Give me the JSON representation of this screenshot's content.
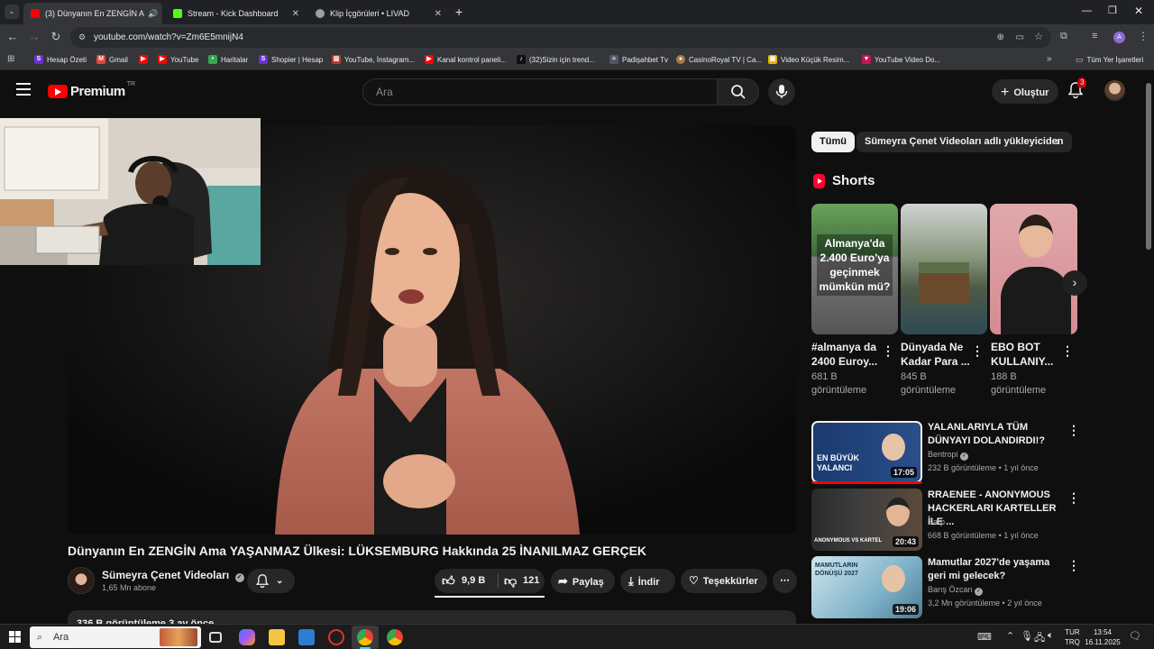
{
  "browser": {
    "tabs": [
      {
        "title": "(3) Dünyanın En ZENGİN A",
        "active": true
      },
      {
        "title": "Stream - Kick Dashboard",
        "active": false
      },
      {
        "title": "Klip İçgörüleri • LIVAD",
        "active": false
      }
    ],
    "url": "youtube.com/watch?v=Zm6E5mnijN4",
    "bookmarks": [
      "Hesap Özeti",
      "Gmail",
      "YouTube",
      "Haritalar",
      "Shopier | Hesap",
      "YouTube, İnstagram...",
      "Kanal kontrol paneli...",
      "(32)Sizin için trend...",
      "Padişahbet Tv",
      "CasinoRoyal TV | Ca...",
      "Video Küçük Resim...",
      "YouTube Video Do..."
    ],
    "all_bookmarks": "Tüm Yer İşaretleri",
    "profile_initial": "A"
  },
  "youtube": {
    "logo_text": "Premium",
    "region": "TR",
    "search_placeholder": "Ara",
    "create_label": "Oluştur",
    "notification_count": "3"
  },
  "video": {
    "title": "Dünyanın En ZENGİN Ama YAŞANMAZ Ülkesi: LÜKSEMBURG Hakkında 25 İNANILMAZ GERÇEK",
    "channel": "Sümeyra Çenet Videoları",
    "subscribers": "1,65 Mn abone",
    "likes": "9,9 B",
    "dislikes": "121",
    "share_label": "Paylaş",
    "download_label": "İndir",
    "thanks_label": "Teşekkürler",
    "description_preview": "336 B görüntüleme  3 ay önce"
  },
  "sidebar": {
    "chips": [
      "Tümü",
      "Sümeyra Çenet Videoları adlı yükleyiciden"
    ],
    "shorts_heading": "Shorts",
    "shorts": [
      {
        "title": "#almanya da 2400 Euroy...",
        "views": "681 B görüntüleme",
        "thumb_text": "Almanya'da 2.400 Euro'ya geçinmek mümkün mü?"
      },
      {
        "title": "Dünyada Ne Kadar Para ...",
        "views": "845 B görüntüleme",
        "thumb_text": ""
      },
      {
        "title": "EBO BOT KULLANIY...",
        "views": "188 B görüntüleme",
        "thumb_text": ""
      }
    ],
    "related": [
      {
        "title": "YALANLARIYLA TÜM DÜNYAYI DOLANDIRDI!?",
        "channel": "Bentropi",
        "views": "232 B görüntüleme",
        "age": "1 yıl önce",
        "duration": "17:05",
        "thumb_text": "EN BÜYÜK YALANCI",
        "verified": true
      },
      {
        "title": "RRAENEE - ANONYMOUS HACKERLARI KARTELLER İLE ...",
        "channel": "Sarp",
        "views": "668 B görüntüleme",
        "age": "1 yıl önce",
        "duration": "20:43",
        "thumb_text": "ANONYMOUS VS KARTEL",
        "verified": false
      },
      {
        "title": "Mamutlar 2027'de yaşama geri mi gelecek?",
        "channel": "Barış Özcan",
        "views": "3,2 Mn görüntüleme",
        "age": "2 yıl önce",
        "duration": "19:06",
        "thumb_text": "MAMUTLARIN DÖNÜŞÜ 2027",
        "verified": true
      }
    ]
  },
  "taskbar": {
    "search_placeholder": "Ara",
    "language": "TUR",
    "layout": "TRQ",
    "time": "13:54",
    "date": "16.11.2025"
  }
}
